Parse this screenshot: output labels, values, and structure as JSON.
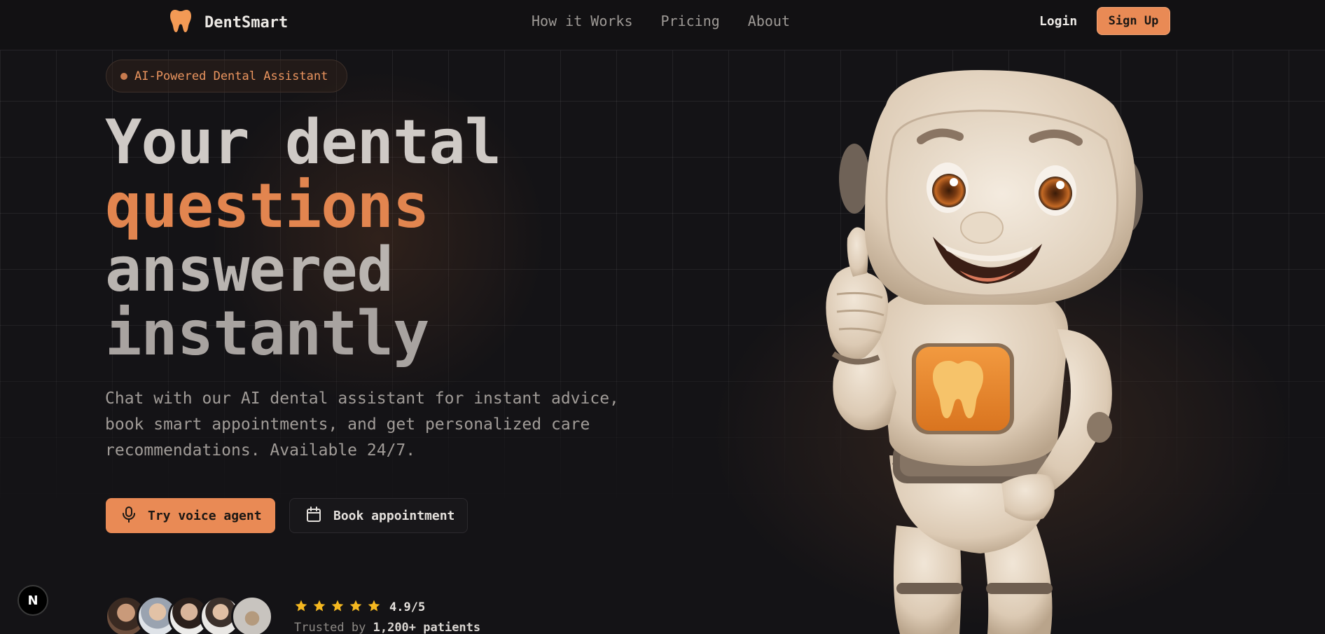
{
  "header": {
    "brand": "DentSmart",
    "nav": [
      "How it Works",
      "Pricing",
      "About"
    ],
    "login": "Login",
    "signup": "Sign Up"
  },
  "hero": {
    "badge": "AI-Powered Dental Assistant",
    "headline": [
      "Your dental",
      "questions",
      "answered",
      "instantly"
    ],
    "subtitle": "Chat with our AI dental assistant for instant advice, book smart appointments, and get personalized care recommendations. Available 24/7.",
    "cta_voice": "Try voice agent",
    "cta_book": "Book appointment",
    "rating": "4.9/5",
    "stars": 5,
    "trusted_prefix": "Trusted by",
    "trusted_count": "1,200+ patients"
  },
  "dev_badge": "N",
  "colors": {
    "accent": "#e98a55",
    "background": "#141316",
    "star": "#f5b820"
  },
  "icons": [
    "tooth-icon",
    "microphone-icon",
    "calendar-icon",
    "star-icon"
  ]
}
